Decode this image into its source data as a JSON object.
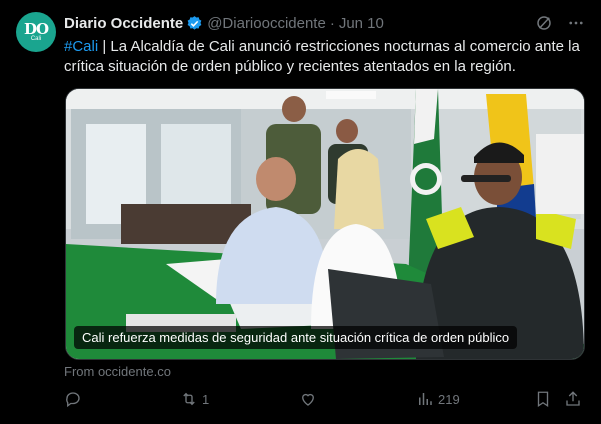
{
  "avatar": {
    "monogram": "DO",
    "city": "Cali"
  },
  "author": {
    "name": "Diario Occidente",
    "handle": "@Diariooccidente",
    "separator": "·",
    "date": "Jun 10"
  },
  "tweet": {
    "hashtag": "#Cali",
    "body": " | La Alcaldía de Cali anunció restricciones nocturnas al comercio ante la crítica situación de orden público y recientes atentados en la región."
  },
  "media": {
    "caption": "Cali refuerza medidas de seguridad ante situación crítica de orden público"
  },
  "source": "From occidente.co",
  "actions": {
    "reply_count": "",
    "retweet_count": "1",
    "like_count": "",
    "views_count": "219"
  },
  "colors": {
    "accent": "#1d9bf0",
    "muted": "#71767b",
    "avatar_bg": "#1aa58f"
  },
  "icons": [
    "verified-badge-icon",
    "grok-icon",
    "more-icon",
    "reply-icon",
    "retweet-icon",
    "like-icon",
    "views-icon",
    "bookmark-icon",
    "share-icon"
  ]
}
